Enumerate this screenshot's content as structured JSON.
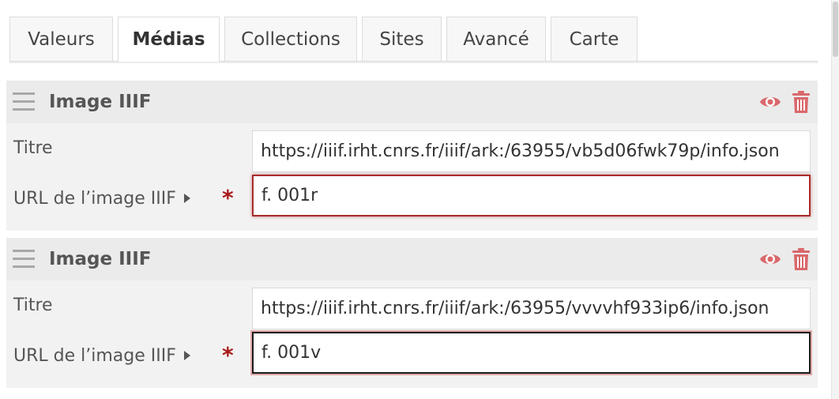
{
  "tabs": [
    {
      "label": "Valeurs",
      "active": false
    },
    {
      "label": "Médias",
      "active": true
    },
    {
      "label": "Collections",
      "active": false
    },
    {
      "label": "Sites",
      "active": false
    },
    {
      "label": "Avancé",
      "active": false
    },
    {
      "label": "Carte",
      "active": false
    }
  ],
  "colors": {
    "accent": "#d9686b",
    "required": "#a91919",
    "invalid_border": "#a92b2b"
  },
  "icons": {
    "drag": "drag-handle-icon",
    "visibility": "eye-icon",
    "delete": "trash-icon",
    "expand": "caret-right-icon",
    "required": "asterisk"
  },
  "media": [
    {
      "title": "Image IIIF",
      "title_label": "Titre",
      "title_value": "https://iiif.irht.cnrs.fr/iiif/ark:/63955/vb5d06fwk79p/info.json",
      "url_label": "URL de l’image IIIF",
      "url_value": "f. 001r",
      "required_mark": "*"
    },
    {
      "title": "Image IIIF",
      "title_label": "Titre",
      "title_value": "https://iiif.irht.cnrs.fr/iiif/ark:/63955/vvvvhf933ip6/info.json",
      "url_label": "URL de l’image IIIF",
      "url_value": "f. 001v",
      "required_mark": "*"
    }
  ]
}
